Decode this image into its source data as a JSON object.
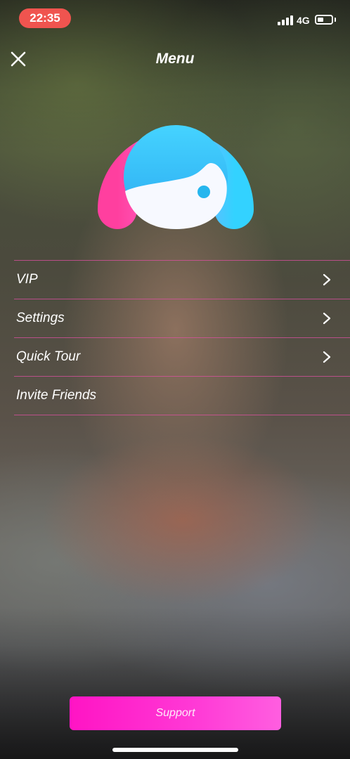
{
  "status_bar": {
    "time": "22:35",
    "network": "4G",
    "battery_level": 0.45
  },
  "header": {
    "title": "Menu",
    "close_icon": "close-icon"
  },
  "logo": {
    "icon": "app-logo-icon",
    "colors": {
      "pink": "#ff4fb0",
      "blue": "#3fc6f5",
      "face": "#ffffff"
    }
  },
  "menu": {
    "items": [
      {
        "label": "VIP",
        "has_chevron": true
      },
      {
        "label": "Settings",
        "has_chevron": true
      },
      {
        "label": "Quick Tour",
        "has_chevron": true
      },
      {
        "label": "Invite Friends",
        "has_chevron": false
      }
    ],
    "divider_color": "#dc50a0"
  },
  "support": {
    "label": "Support",
    "color": "#ff14c4"
  }
}
